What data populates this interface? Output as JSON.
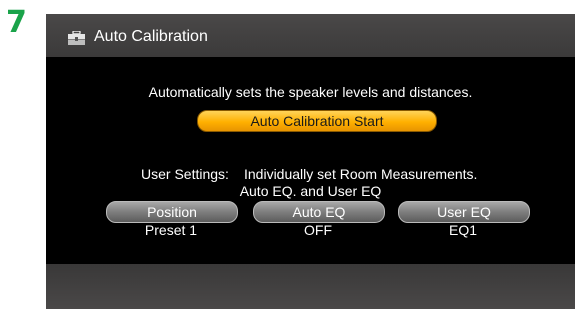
{
  "step_number": "7",
  "header": {
    "title": "Auto Calibration",
    "icon": "toolbox-icon"
  },
  "description": "Automatically sets the speaker levels and distances.",
  "start_button": {
    "label": "Auto Calibration Start"
  },
  "user_settings": {
    "label": "User Settings:",
    "desc_line1": "Individually set Room Measurements.",
    "desc_line2": "Auto EQ. and User EQ"
  },
  "options": [
    {
      "label": "Position",
      "value": "Preset 1"
    },
    {
      "label": "Auto EQ",
      "value": "OFF"
    },
    {
      "label": "User EQ",
      "value": "EQ1"
    }
  ],
  "colors": {
    "step_number": "#1aa34a",
    "start_button": "#ffb000",
    "screen_background": "#000000"
  }
}
